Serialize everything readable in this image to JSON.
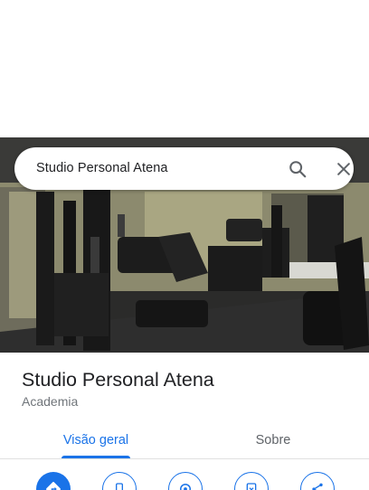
{
  "search": {
    "query": "Studio Personal Atena"
  },
  "place": {
    "name": "Studio Personal Atena",
    "category": "Academia"
  },
  "tabs": [
    {
      "label": "Visão geral",
      "active": true
    },
    {
      "label": "Sobre",
      "active": false
    }
  ],
  "actions": [
    {
      "icon": "directions-icon"
    },
    {
      "icon": "phone-icon"
    },
    {
      "icon": "location-icon"
    },
    {
      "icon": "save-icon"
    },
    {
      "icon": "share-icon"
    }
  ],
  "colors": {
    "accent": "#1a73e8",
    "text_primary": "#202124",
    "text_secondary": "#70757a"
  }
}
